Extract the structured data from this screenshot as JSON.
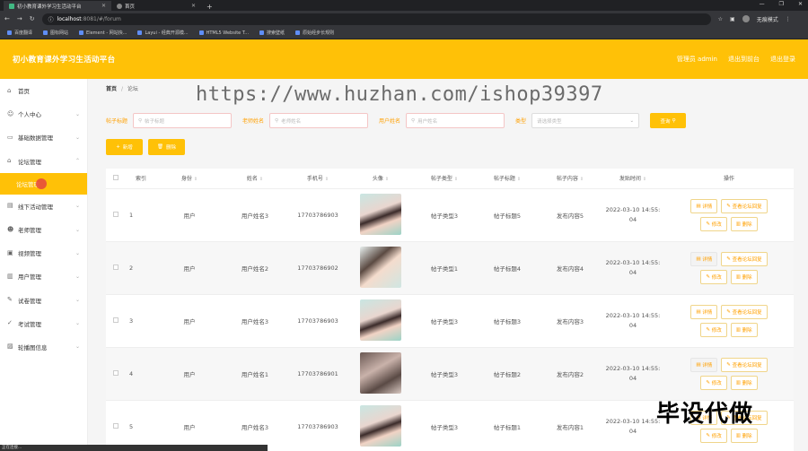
{
  "browser": {
    "tabs": [
      {
        "label": "初小教育课外学习生活动平台",
        "active": true
      },
      {
        "label": "首页",
        "active": false
      }
    ],
    "url_host": "localhost",
    "url_rest": ":8081/#/forum",
    "profile_label": "无痕模式",
    "bookmarks": [
      "百度翻译",
      "图标网站",
      "Element - 网站快...",
      "Layui - 经典开源模...",
      "HTML5 Website T...",
      "搜索壁纸",
      "原始经步长规则"
    ]
  },
  "header": {
    "title": "初小教育课外学习生活动平台",
    "admin_label": "管理员 admin",
    "back_label": "退出到前台",
    "logout_label": "退出登录"
  },
  "sidebar": {
    "items": [
      {
        "label": "首页",
        "icon": "home-icon",
        "has_children": false
      },
      {
        "label": "个人中心",
        "icon": "user-icon",
        "has_children": true
      },
      {
        "label": "基础数据管理",
        "icon": "folder-icon",
        "has_children": true
      },
      {
        "label": "论坛管理",
        "icon": "home-icon",
        "has_children": true
      }
    ],
    "active_sub": "论坛管理",
    "items_after": [
      {
        "label": "线下活动管理",
        "icon": "doc-icon"
      },
      {
        "label": "老师管理",
        "icon": "person-icon"
      },
      {
        "label": "视频管理",
        "icon": "video-icon"
      },
      {
        "label": "用户管理",
        "icon": "users-icon"
      },
      {
        "label": "试卷管理",
        "icon": "paper-icon"
      },
      {
        "label": "考试管理",
        "icon": "exam-icon"
      },
      {
        "label": "轮播图信息",
        "icon": "image-icon"
      }
    ]
  },
  "breadcrumb": {
    "home": "首页",
    "current": "论坛"
  },
  "watermark": "https://www.huzhan.com/ishop39397",
  "filters": {
    "title_label": "帖子标题",
    "title_placeholder": "帖子标题",
    "teacher_label": "老师姓名",
    "teacher_placeholder": "老师姓名",
    "user_label": "用户姓名",
    "user_placeholder": "用户姓名",
    "type_label": "类型",
    "type_placeholder": "请选择类型",
    "query_button": "查询"
  },
  "toolbar": {
    "add_label": "新增",
    "delete_label": "删除"
  },
  "table": {
    "headers": [
      "索引",
      "身份",
      "姓名",
      "手机号",
      "头像",
      "帖子类型",
      "帖子标题",
      "帖子内容",
      "发贴时间",
      "操作"
    ],
    "rows": [
      {
        "idx": "1",
        "role": "用户",
        "name": "用户姓名3",
        "phone": "17703786903",
        "type": "帖子类型3",
        "title": "帖子标题5",
        "content": "发布内容5",
        "time1": "2022-03-10 14:55:",
        "time2": "04"
      },
      {
        "idx": "2",
        "role": "用户",
        "name": "用户姓名2",
        "phone": "17703786902",
        "type": "帖子类型1",
        "title": "帖子标题4",
        "content": "发布内容4",
        "time1": "2022-03-10 14:55:",
        "time2": "04"
      },
      {
        "idx": "3",
        "role": "用户",
        "name": "用户姓名3",
        "phone": "17703786903",
        "type": "帖子类型3",
        "title": "帖子标题3",
        "content": "发布内容3",
        "time1": "2022-03-10 14:55:",
        "time2": "04"
      },
      {
        "idx": "4",
        "role": "用户",
        "name": "用户姓名1",
        "phone": "17703786901",
        "type": "帖子类型3",
        "title": "帖子标题2",
        "content": "发布内容2",
        "time1": "2022-03-10 14:55:",
        "time2": "04"
      },
      {
        "idx": "5",
        "role": "用户",
        "name": "用户姓名3",
        "phone": "17703786903",
        "type": "帖子类型3",
        "title": "帖子标题1",
        "content": "发布内容1",
        "time1": "2022-03-10 14:55:",
        "time2": "04"
      }
    ],
    "op_detail": "详情",
    "op_reply": "查看论坛回复",
    "op_edit": "修改",
    "op_delete": "删除"
  },
  "overlay_text": "毕设代做",
  "status_text": "正在连接..."
}
